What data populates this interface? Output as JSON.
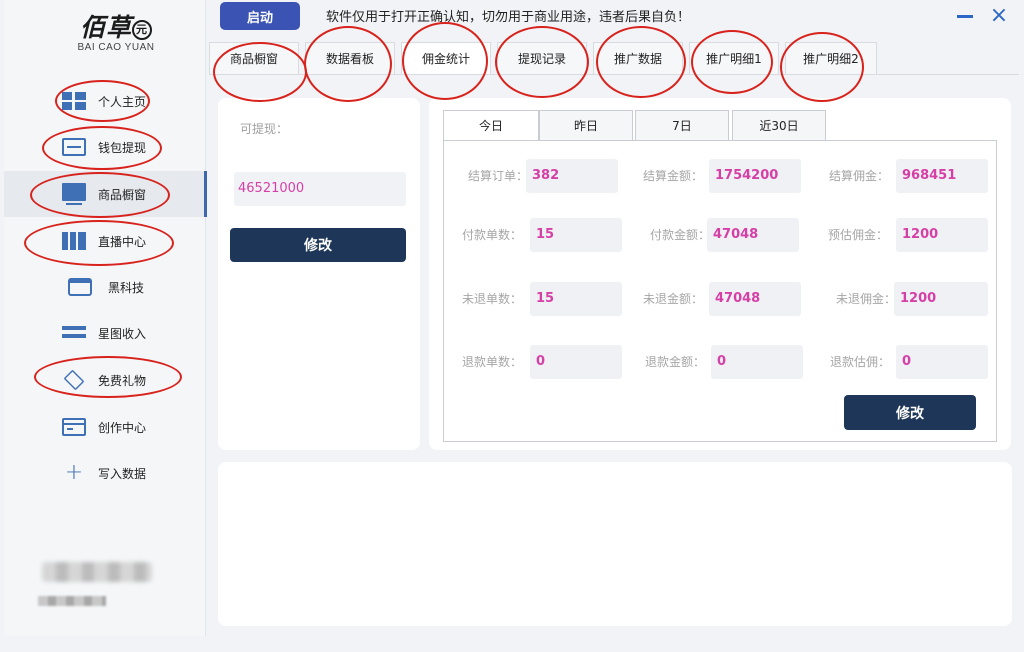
{
  "sidebar": {
    "logo_text": "佰草",
    "logo_seal": "元",
    "logo_sub": "BAI CAO YUAN",
    "items": [
      {
        "label": "个人主页",
        "icon": "dashboard-icon"
      },
      {
        "label": "钱包提现",
        "icon": "wallet-card-icon"
      },
      {
        "label": "商品橱窗",
        "icon": "monitor-icon"
      },
      {
        "label": "直播中心",
        "icon": "panels-icon"
      },
      {
        "label": "黑科技",
        "icon": "store-icon"
      },
      {
        "label": "星图收入",
        "icon": "bars-icon"
      },
      {
        "label": "免费礼物",
        "icon": "layers-icon"
      },
      {
        "label": "创作中心",
        "icon": "window-icon"
      },
      {
        "label": "写入数据",
        "icon": "plus-icon"
      }
    ],
    "active_index": 2
  },
  "header": {
    "start_label": "启动",
    "notice": "软件仅用于打开正确认知，切勿用于商业用途，违者后果自负！",
    "minimize_symbol": "—",
    "close_symbol": "×"
  },
  "top_tabs": [
    "商品橱窗",
    "数据看板",
    "佣金统计",
    "提现记录",
    "推广数据",
    "推广明细1",
    "推广明细2"
  ],
  "top_tab_active": 2,
  "withdraw": {
    "label": "可提现：",
    "value": "46521000",
    "modify_label": "修改"
  },
  "sub_tabs": [
    "今日",
    "昨日",
    "7日",
    "近30日"
  ],
  "sub_tab_active": 0,
  "stats": [
    {
      "label": "结算订单：",
      "value": "382"
    },
    {
      "label": "结算金额：",
      "value": "1754200"
    },
    {
      "label": "结算佣金：",
      "value": "968451"
    },
    {
      "label": "付款单数：",
      "value": "15"
    },
    {
      "label": "付款金额：",
      "value": "47048"
    },
    {
      "label": "预估佣金：",
      "value": "1200"
    },
    {
      "label": "未退单数：",
      "value": "15"
    },
    {
      "label": "未退金额：",
      "value": "47048"
    },
    {
      "label": "未退佣金：",
      "value": "1200"
    },
    {
      "label": "退款单数：",
      "value": "0"
    },
    {
      "label": "退款金额：",
      "value": "0"
    },
    {
      "label": "退款估佣：",
      "value": "0"
    }
  ],
  "stats_modify_label": "修改",
  "colors": {
    "accent_blue": "#3b54b3",
    "dark_button": "#1e3758",
    "value_pink": "#d63fa6",
    "annotation_red": "#d8221c"
  }
}
